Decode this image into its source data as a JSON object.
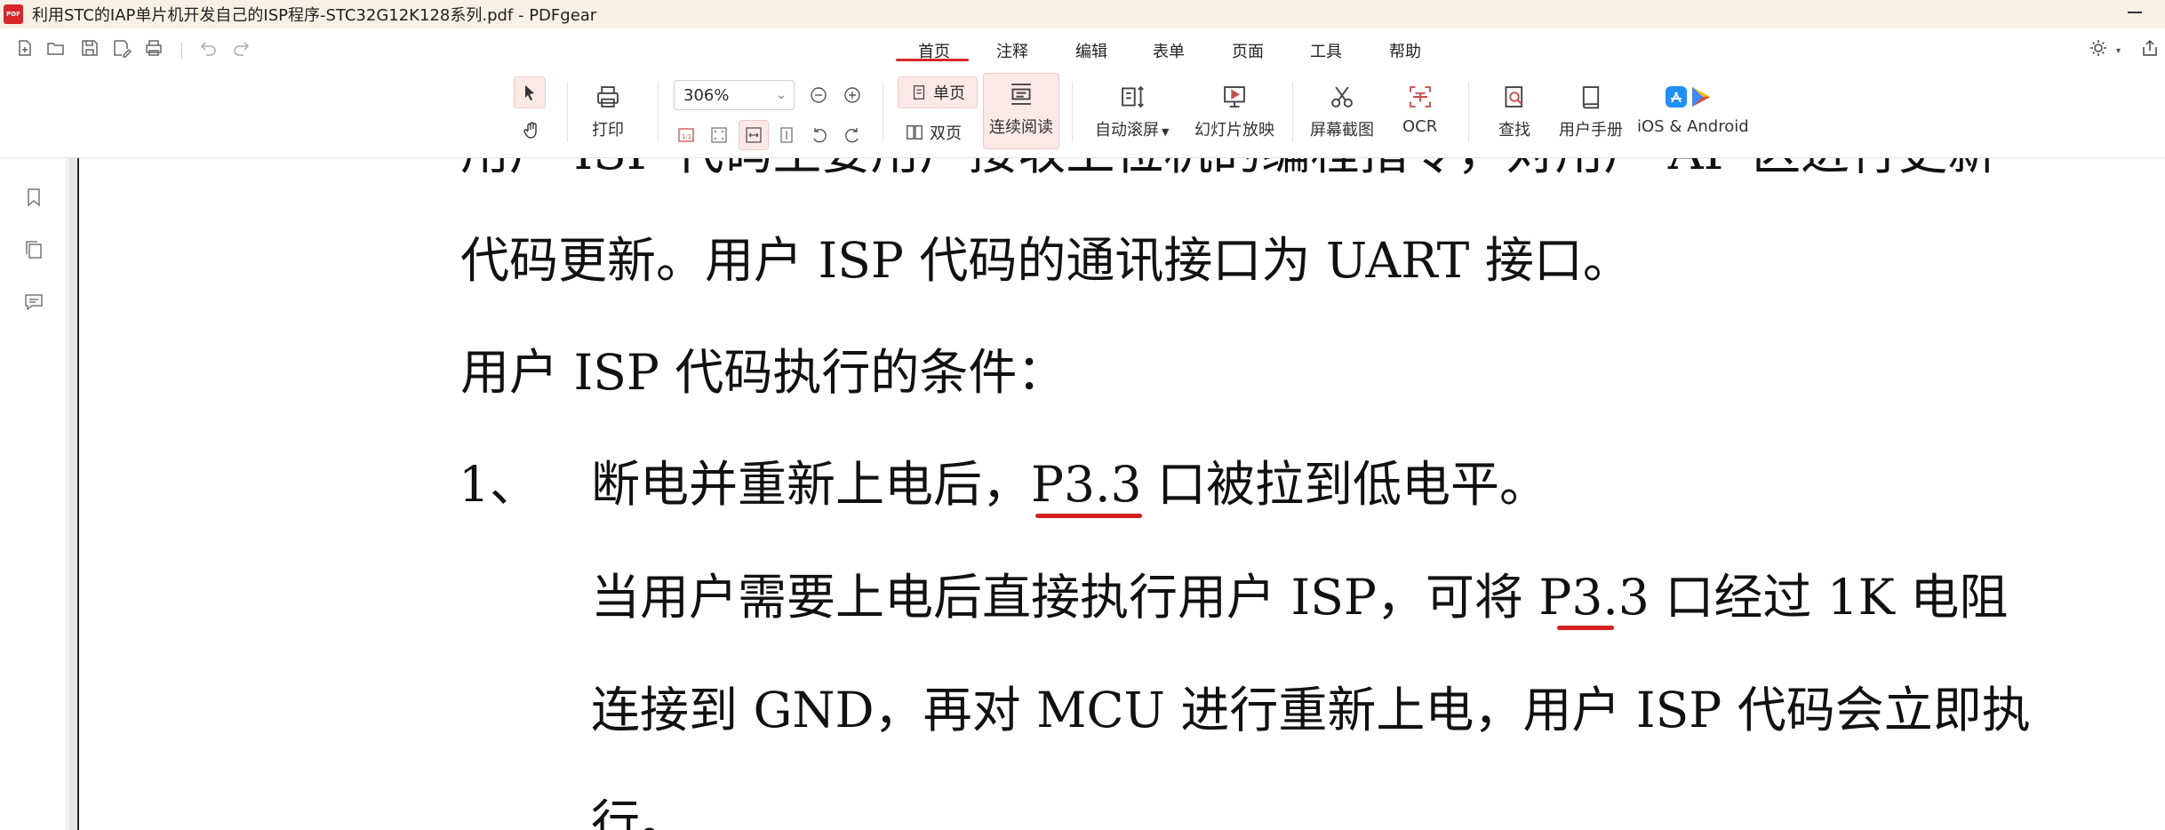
{
  "window": {
    "app_icon_text": "PDF",
    "title": "利用STC的IAP单片机开发自己的ISP程序-STC32G12K128系列.pdf - PDFgear"
  },
  "tabs": [
    {
      "label": "首页",
      "active": true
    },
    {
      "label": "注释"
    },
    {
      "label": "编辑"
    },
    {
      "label": "表单"
    },
    {
      "label": "页面"
    },
    {
      "label": "工具"
    },
    {
      "label": "帮助"
    }
  ],
  "ribbon": {
    "print_label": "打印",
    "zoom_value": "306%",
    "single_page_label": "单页",
    "double_page_label": "双页",
    "continuous_label": "连续阅读",
    "auto_scroll_label": "自动滚屏",
    "slideshow_label": "幻灯片放映",
    "screenshot_label": "屏幕截图",
    "ocr_label": "OCR",
    "find_label": "查找",
    "manual_label": "用户手册",
    "mobile_label": "iOS & Android"
  },
  "document": {
    "line_partial": "用户 ISP 代码主要用户接收上位机的编程指令，对用户 AP 区进行更新",
    "line1": "代码更新。用户 ISP 代码的通讯接口为 UART 接口。",
    "line2": "用户 ISP 代码执行的条件：",
    "item_number": "1、",
    "item_text": "断电并重新上电后，P3.3 口被拉到低电平。",
    "para1": "当用户需要上电后直接执行用户 ISP，可将 P3.3 口经过 1K 电阻",
    "para2": "连接到 GND，再对 MCU 进行重新上电，用户 ISP 代码会立即执",
    "para3": "行。"
  },
  "colors": {
    "accent": "#d6282e",
    "annotation_underline": "#d62020"
  }
}
